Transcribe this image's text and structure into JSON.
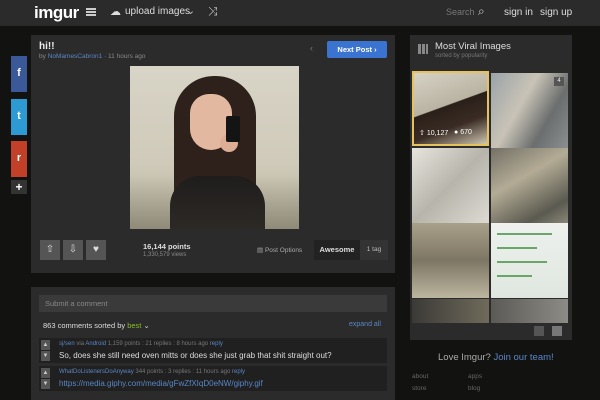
{
  "header": {
    "logo": "imgur",
    "upload_label": "upload images",
    "search_placeholder": "Search",
    "signin": "sign in",
    "signup": "sign up"
  },
  "share": {
    "facebook": "f",
    "twitter": "t",
    "reddit": "r",
    "more": "+"
  },
  "post": {
    "title": "hi!!",
    "meta_prefix": "by",
    "author": "NoMamesCabron1",
    "time": "· 11 hours ago",
    "next_label": "Next Post ›",
    "prev_label": "‹",
    "points": "16,144 points",
    "views": "1,330,579 views",
    "post_options": "Post Options",
    "awesome": "Awesome",
    "tags": "1 tag"
  },
  "comments": {
    "input_placeholder": "Submit a comment",
    "count_label": "863 comments sorted by",
    "sort": "best",
    "expand": "expand all",
    "items": [
      {
        "user": "sj/sen",
        "via": "via",
        "platform": "Android",
        "stats": "1,159 points : 21 replies : 8 hours ago",
        "reply": "reply",
        "text": "So, does she still need oven mitts or does she just grab that shit straight out?"
      },
      {
        "user": "WhatDoListenersDoAnyway",
        "stats": "344 points : 3 replies : 11 hours ago",
        "reply": "reply",
        "text": "https://media.giphy.com/media/gFwZfXIqD0eNW/giphy.gif"
      }
    ]
  },
  "viral": {
    "title": "Most Viral Images",
    "subtitle": "sorted by popularity",
    "thumb1_points": "10,127",
    "thumb1_comments": "670",
    "thumb2_badge": "4"
  },
  "footer": {
    "love": "Love Imgur?",
    "join": "Join our team!",
    "about": "about",
    "store": "store",
    "apps": "apps",
    "blog": "blog"
  }
}
